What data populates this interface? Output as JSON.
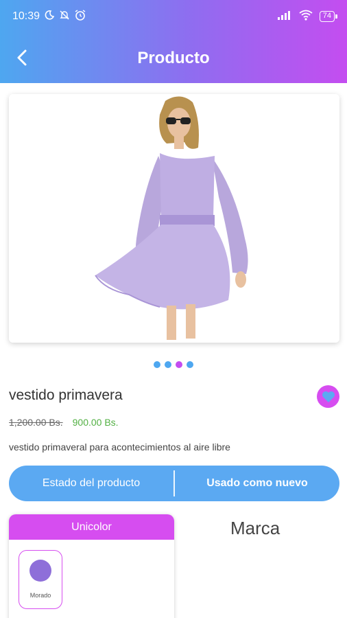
{
  "status_bar": {
    "time": "10:39",
    "battery": "74"
  },
  "app_bar": {
    "title": "Producto"
  },
  "product": {
    "name": "vestido primavera",
    "old_price": "1,200.00 Bs.",
    "new_price": "900.00 Bs.",
    "description": "vestido primaveral para acontecimientos al aire libre",
    "carousel": {
      "total": 4,
      "active_index": 2
    }
  },
  "state": {
    "label": "Estado del producto",
    "value": "Usado como nuevo"
  },
  "colors": {
    "header": "Unicolor",
    "options": [
      {
        "label": "Morado",
        "hex": "#8e6fd9"
      }
    ]
  },
  "brand": {
    "title": "Marca"
  },
  "theme": {
    "gradient_start": "#4ea7f0",
    "gradient_end": "#c44df0",
    "accent": "#d64df0",
    "pill": "#5ba9f2",
    "price_green": "#52b043"
  }
}
